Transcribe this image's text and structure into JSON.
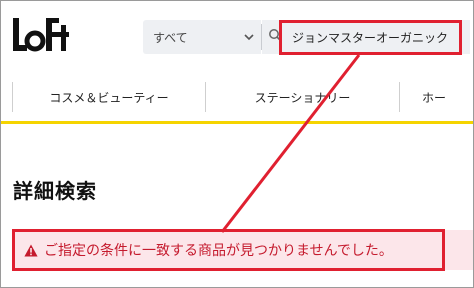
{
  "header": {
    "logo_text": "LoFt",
    "category_select": {
      "selected": "すべて"
    },
    "search": {
      "value": "ジョンマスターオーガニック",
      "placeholder": ""
    }
  },
  "nav": {
    "items": [
      {
        "label": "コスメ＆ビューティー"
      },
      {
        "label": "ステーショナリー"
      },
      {
        "label": "ホー"
      }
    ]
  },
  "main": {
    "title": "詳細検索",
    "alert": {
      "message": "ご指定の条件に一致する商品が見つかりませんでした。"
    }
  },
  "icons": {
    "logo": "loft-logo",
    "select_chevron": "chevron-down-icon",
    "search": "search-icon",
    "alert": "warning-icon"
  },
  "colors": {
    "accent_yellow": "#f5d400",
    "annotation_red": "#e02030",
    "alert_text": "#c51b2e",
    "alert_background": "#fce6ea",
    "search_background": "#eef0f3"
  }
}
